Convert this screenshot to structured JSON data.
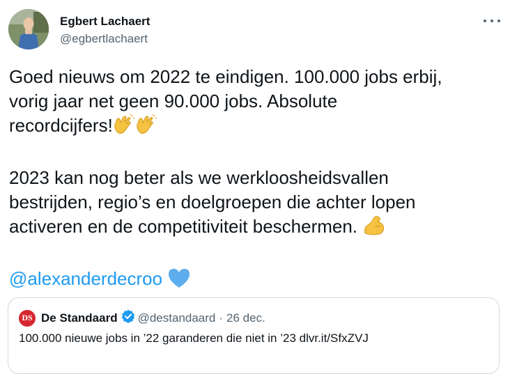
{
  "author": {
    "name": "Egbert Lachaert",
    "handle": "@egbertlachaert"
  },
  "tweet": {
    "line1": "Goed nieuws om 2022 te eindigen. 100.000 jobs erbij,",
    "line2": "vorig jaar net geen 90.000 jobs. Absolute",
    "line3": "recordcijfers!",
    "line4": "2023 kan nog beter als we werkloosheidsvallen",
    "line5": "bestrijden, regio’s en doelgroepen die achter lopen",
    "line6": "activeren en de competitiviteit beschermen.",
    "mention": "@alexanderdecroo",
    "emojis": [
      "clapping-hands",
      "clapping-hands",
      "flexed-biceps",
      "blue-heart"
    ]
  },
  "quote": {
    "logo_text": "DS",
    "name": "De Standaard",
    "handle": "@destandaard",
    "separator": "·",
    "date": "26 dec.",
    "text": "100.000 nieuwe jobs in ’22 garanderen die niet in ’23 dlvr.it/SfxZVJ"
  },
  "colors": {
    "link": "#1d9bf0",
    "secondary_text": "#536471",
    "logo_red": "#d7262f",
    "border": "#cfd9de"
  }
}
